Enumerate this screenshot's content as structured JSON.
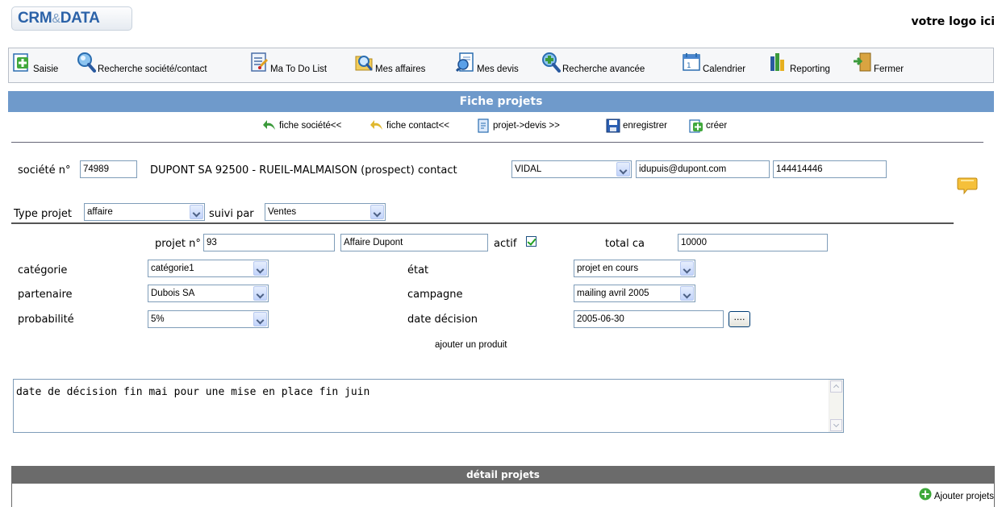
{
  "header": {
    "logo_parts": [
      "CRM",
      "&",
      "DATA"
    ],
    "logo_placeholder": "votre logo ici"
  },
  "toolbar": {
    "items": [
      {
        "label": "Saisie",
        "icon": "add-document-icon"
      },
      {
        "label": "Recherche société/contact",
        "icon": "magnifier-icon"
      },
      {
        "label": "Ma To Do List",
        "icon": "todo-list-icon"
      },
      {
        "label": "Mes affaires",
        "icon": "folder-search-icon"
      },
      {
        "label": "Mes devis",
        "icon": "quote-search-icon"
      },
      {
        "label": "Recherche avancée",
        "icon": "advanced-search-icon"
      },
      {
        "label": "Calendrier",
        "icon": "calendar-icon"
      },
      {
        "label": "Reporting",
        "icon": "bar-chart-icon"
      },
      {
        "label": "Fermer",
        "icon": "exit-door-icon"
      }
    ]
  },
  "page_title": "Fiche projets",
  "actions": {
    "fiche_societe": "fiche société<<",
    "fiche_contact": "fiche contact<<",
    "projet_devis": "projet->devis >>",
    "enregistrer": "enregistrer",
    "creer": "créer"
  },
  "company": {
    "label": "société n°",
    "number": "74989",
    "description": "DUPONT SA 92500 - RUEIL-MALMAISON (prospect) contact",
    "contact_selected": "VIDAL",
    "email": "idupuis@dupont.com",
    "phone": "144414446"
  },
  "type_row": {
    "type_label": "Type projet",
    "type_value": "affaire",
    "suivi_label": "suivi par",
    "suivi_value": "Ventes"
  },
  "project": {
    "number_label": "projet n°",
    "number": "93",
    "name": "Affaire Dupont",
    "actif_label": "actif",
    "actif_checked": true,
    "total_label": "total ca",
    "total_value": "10000"
  },
  "fields": {
    "categorie_label": "catégorie",
    "categorie_value": "catégorie1",
    "partenaire_label": "partenaire",
    "partenaire_value": "Dubois SA",
    "probabilite_label": "probabilité",
    "probabilite_value": "5%",
    "etat_label": "état",
    "etat_value": "projet en cours",
    "campagne_label": "campagne",
    "campagne_value": "mailing avril 2005",
    "date_label": "date décision",
    "date_value": "2005-06-30",
    "date_button": "...."
  },
  "add_product": "ajouter un produit",
  "notes": "date de décision fin mai pour une mise en place fin juin",
  "detail": {
    "title": "détail projets",
    "add_label": "Ajouter projets"
  },
  "colors": {
    "title_bar": "#6f9acb",
    "detail_bar": "#6b6b6b",
    "input_border": "#7f9db9"
  }
}
